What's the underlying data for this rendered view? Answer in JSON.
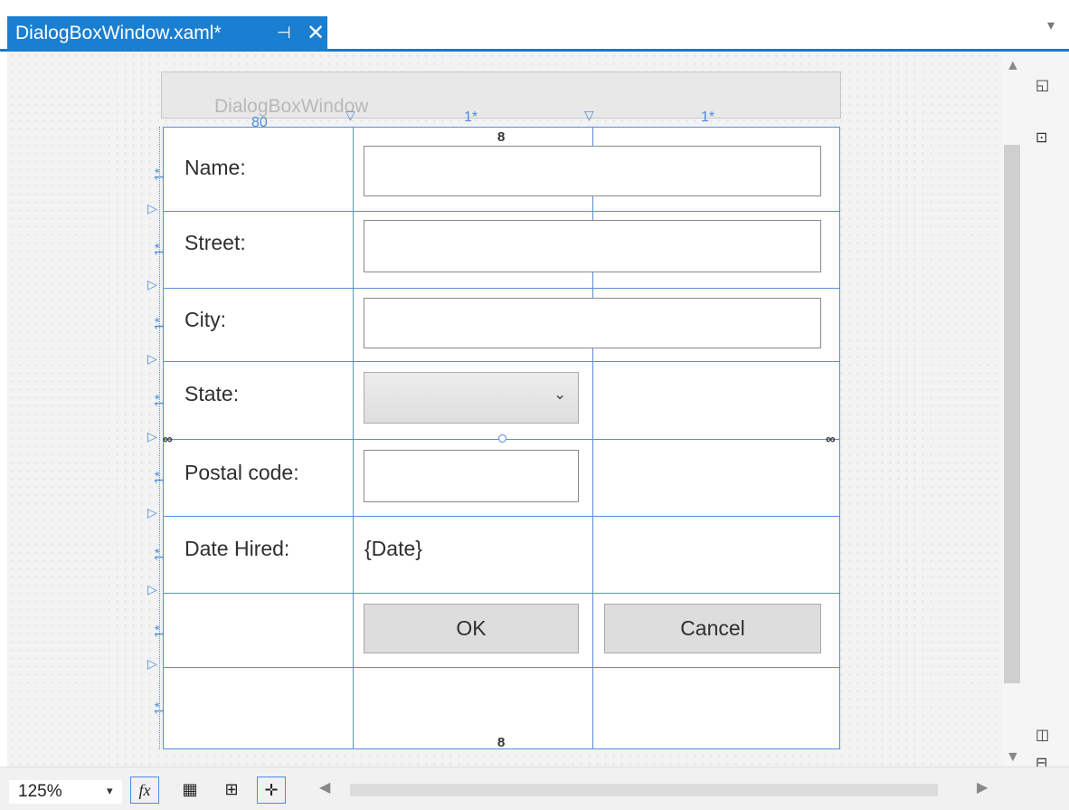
{
  "tab": {
    "title": "DialogBoxWindow.xaml*",
    "pin_glyph": "⊣",
    "close_glyph": "✕"
  },
  "window": {
    "title": "DialogBoxWindow"
  },
  "grid": {
    "column_sizes": [
      "80",
      "1*",
      "1*"
    ],
    "row_size_label": "1*"
  },
  "form": {
    "labels": {
      "name": "Name:",
      "street": "Street:",
      "city": "City:",
      "state": "State:",
      "postal_code": "Postal code:",
      "date_hired": "Date Hired:"
    },
    "date_value": "{Date}",
    "ok_label": "OK",
    "cancel_label": "Cancel"
  },
  "toolbar": {
    "zoom": "125%",
    "fx_label": "fx"
  },
  "icons": {
    "pin": "pin-icon",
    "close": "close-icon",
    "chevron": "chevron-down-icon",
    "chain": "chain-link-icon"
  },
  "colors": {
    "accent": "#1b7fd1",
    "gridline": "#5a8fd6"
  }
}
